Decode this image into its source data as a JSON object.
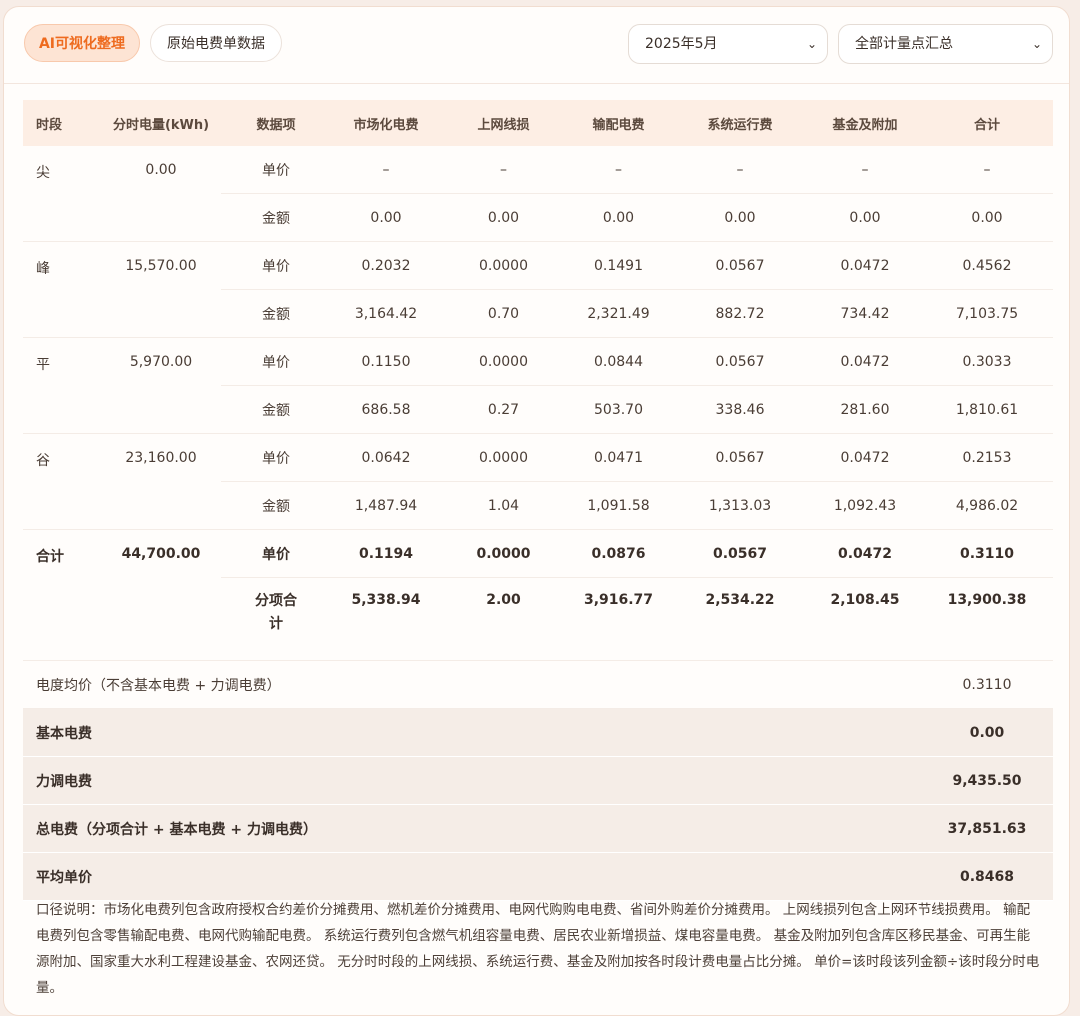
{
  "tabs": [
    {
      "label": "AI可视化整理",
      "active": true
    },
    {
      "label": "原始电费单数据",
      "active": false
    }
  ],
  "filters": {
    "month": "2025年5月",
    "meter": "全部计量点汇总"
  },
  "table": {
    "headers": [
      "时段",
      "分时电量(kWh)",
      "数据项",
      "市场化电费",
      "上网线损",
      "输配电费",
      "系统运行费",
      "基金及附加",
      "合计"
    ],
    "periods": [
      {
        "name": "尖",
        "energy": "0.00",
        "price_label": "单价",
        "prices": [
          "–",
          "–",
          "–",
          "–",
          "–",
          "–"
        ],
        "amount_label": "金额",
        "amounts": [
          "0.00",
          "0.00",
          "0.00",
          "0.00",
          "0.00",
          "0.00"
        ]
      },
      {
        "name": "峰",
        "energy": "15,570.00",
        "price_label": "单价",
        "prices": [
          "0.2032",
          "0.0000",
          "0.1491",
          "0.0567",
          "0.0472",
          "0.4562"
        ],
        "amount_label": "金额",
        "amounts": [
          "3,164.42",
          "0.70",
          "2,321.49",
          "882.72",
          "734.42",
          "7,103.75"
        ]
      },
      {
        "name": "平",
        "energy": "5,970.00",
        "price_label": "单价",
        "prices": [
          "0.1150",
          "0.0000",
          "0.0844",
          "0.0567",
          "0.0472",
          "0.3033"
        ],
        "amount_label": "金额",
        "amounts": [
          "686.58",
          "0.27",
          "503.70",
          "338.46",
          "281.60",
          "1,810.61"
        ]
      },
      {
        "name": "谷",
        "energy": "23,160.00",
        "price_label": "单价",
        "prices": [
          "0.0642",
          "0.0000",
          "0.0471",
          "0.0567",
          "0.0472",
          "0.2153"
        ],
        "amount_label": "金额",
        "amounts": [
          "1,487.94",
          "1.04",
          "1,091.58",
          "1,313.03",
          "1,092.43",
          "4,986.02"
        ]
      }
    ],
    "total": {
      "name": "合计",
      "energy": "44,700.00",
      "price_label": "单价",
      "prices": [
        "0.1194",
        "0.0000",
        "0.0876",
        "0.0567",
        "0.0472",
        "0.3110"
      ],
      "amount_label_1": "分项合",
      "amount_label_2": "计",
      "amounts": [
        "5,338.94",
        "2.00",
        "3,916.77",
        "2,534.22",
        "2,108.45",
        "13,900.38"
      ]
    },
    "avg_price": {
      "label": "电度均价（不含基本电费 + 力调电费）",
      "value": "0.3110"
    },
    "summary": [
      {
        "label": "基本电费",
        "value": "0.00"
      },
      {
        "label": "力调电费",
        "value": "9,435.50"
      },
      {
        "label": "总电费（分项合计 + 基本电费 + 力调电费）",
        "value": "37,851.63"
      },
      {
        "label": "平均单价",
        "value": "0.8468"
      }
    ]
  },
  "note": "口径说明：市场化电费列包含政府授权合约差价分摊费用、燃机差价分摊费用、电网代购购电电费、省间外购差价分摊费用。 上网线损列包含上网环节线损费用。 输配电费列包含零售输配电费、电网代购输配电费。 系统运行费列包含燃气机组容量电费、居民农业新增损益、煤电容量电费。 基金及附加列包含库区移民基金、可再生能源附加、国家重大水利工程建设基金、农网还贷。 无分时时段的上网线损、系统运行费、基金及附加按各时段计费电量占比分摊。 单价=该时段该列金额÷该时段分时电量。"
}
